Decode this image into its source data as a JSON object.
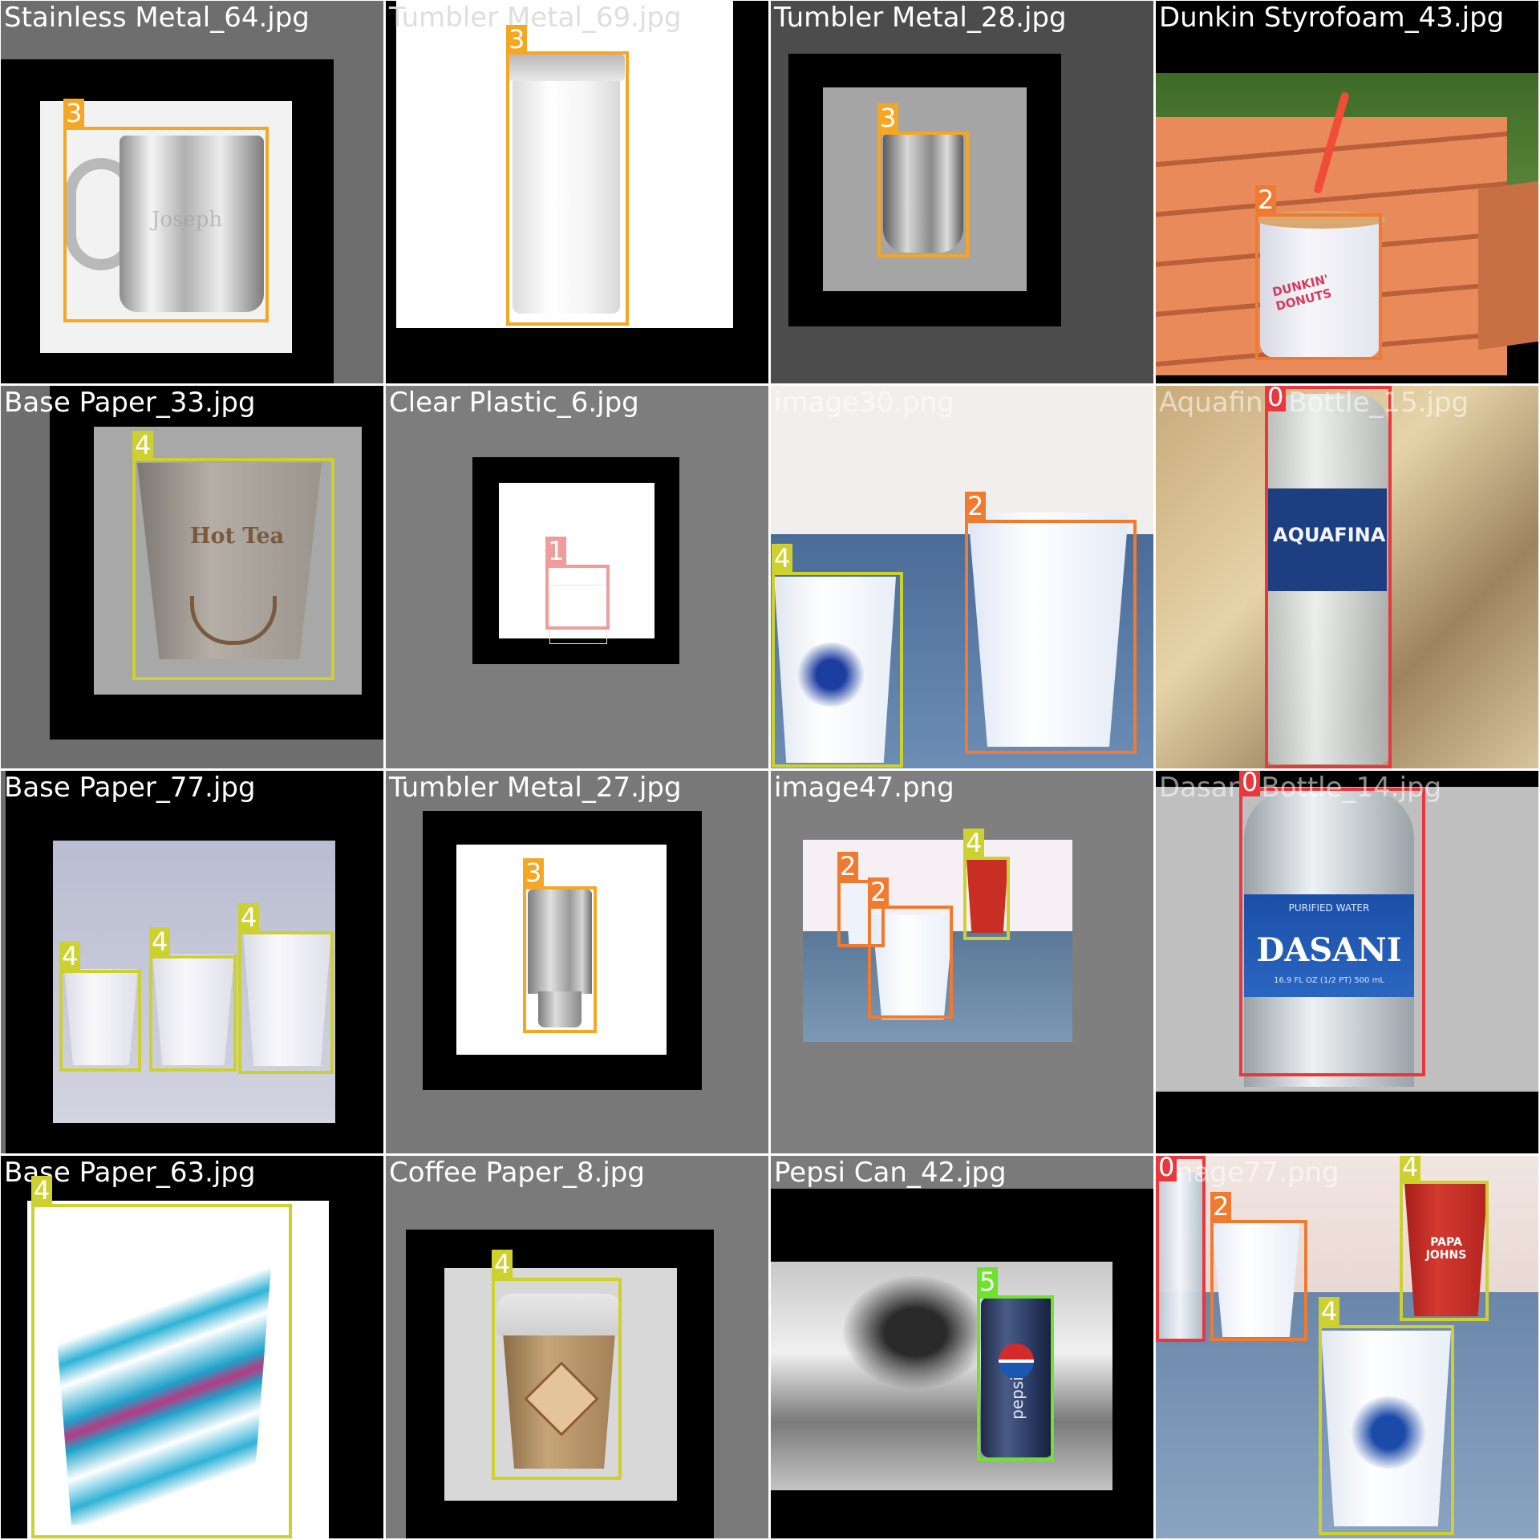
{
  "colors": {
    "class0": "#e8383d",
    "class1": "#ef9c9c",
    "class2": "#f07a30",
    "class3": "#f5a623",
    "class4": "#cdd12f",
    "class5": "#6fe12f"
  },
  "tiles": [
    {
      "file": "Stainless Metal_64.jpg",
      "detections": [
        {
          "cls": "3"
        }
      ]
    },
    {
      "file": "Tumbler Metal_69.jpg",
      "detections": [
        {
          "cls": "3"
        }
      ]
    },
    {
      "file": "Tumbler Metal_28.jpg",
      "detections": [
        {
          "cls": "3"
        }
      ]
    },
    {
      "file": "Dunkin Styrofoam_43.jpg",
      "detections": [
        {
          "cls": "2"
        }
      ]
    },
    {
      "file": "Base Paper_33.jpg",
      "detections": [
        {
          "cls": "4"
        }
      ]
    },
    {
      "file": "Clear Plastic_6.jpg",
      "detections": [
        {
          "cls": "1"
        }
      ]
    },
    {
      "file": "image30.png",
      "detections": [
        {
          "cls": "4"
        },
        {
          "cls": "2"
        }
      ]
    },
    {
      "file": "Aquafina Bottle_15.jpg",
      "detections": [
        {
          "cls": "0"
        }
      ]
    },
    {
      "file": "Base Paper_77.jpg",
      "detections": [
        {
          "cls": "4"
        },
        {
          "cls": "4"
        },
        {
          "cls": "4"
        }
      ]
    },
    {
      "file": "Tumbler Metal_27.jpg",
      "detections": [
        {
          "cls": "3"
        }
      ]
    },
    {
      "file": "image47.png",
      "detections": [
        {
          "cls": "2"
        },
        {
          "cls": "2"
        },
        {
          "cls": "4"
        }
      ]
    },
    {
      "file": "Dasani Bottle_14.jpg",
      "detections": [
        {
          "cls": "0"
        }
      ]
    },
    {
      "file": "Base Paper_63.jpg",
      "detections": [
        {
          "cls": "4"
        }
      ]
    },
    {
      "file": "Coffee Paper_8.jpg",
      "detections": [
        {
          "cls": "4"
        }
      ]
    },
    {
      "file": "Pepsi Can_42.jpg",
      "detections": [
        {
          "cls": "5"
        }
      ]
    },
    {
      "file": "image77.png",
      "detections": [
        {
          "cls": "0"
        },
        {
          "cls": "2"
        },
        {
          "cls": "4"
        },
        {
          "cls": "4"
        }
      ]
    }
  ],
  "product_text": {
    "mug_engraving": "Joseph",
    "tea_cup": "Hot Tea",
    "dunkin_logo": "DUNKIN' DONUTS",
    "aquafina": "AQUAFINA",
    "dasani_top": "PURIFIED WATER",
    "dasani": "DASANI",
    "dasani_volume": "16.9 FL OZ (1/2 PT) 500 mL",
    "pepsi": "pepsi",
    "papa_johns": "PAPA JOHNS"
  }
}
